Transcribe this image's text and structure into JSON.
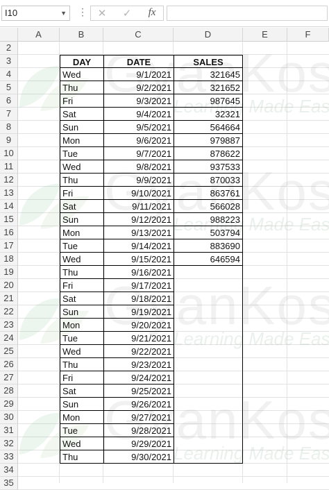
{
  "formula_bar": {
    "name_box": "I10",
    "icons": [
      "more-options-icon",
      "cancel-x-icon",
      "enter-check-icon",
      "insert-function-icon"
    ],
    "fx_label": "fx",
    "formula": ""
  },
  "columns": [
    "A",
    "B",
    "C",
    "D",
    "E",
    "F"
  ],
  "row_numbers": [
    "2",
    "3",
    "4",
    "5",
    "6",
    "7",
    "8",
    "9",
    "10",
    "11",
    "12",
    "13",
    "14",
    "15",
    "16",
    "17",
    "18",
    "19",
    "20",
    "21",
    "22",
    "23",
    "24",
    "25",
    "26",
    "27",
    "28",
    "29",
    "30",
    "31",
    "32",
    "33",
    "34",
    "35"
  ],
  "table": {
    "headers": [
      "DAY",
      "DATE",
      "SALES"
    ],
    "rows": [
      {
        "day": "Wed",
        "date": "9/1/2021",
        "sales": "321645"
      },
      {
        "day": "Thu",
        "date": "9/2/2021",
        "sales": "321652"
      },
      {
        "day": "Fri",
        "date": "9/3/2021",
        "sales": "987645"
      },
      {
        "day": "Sat",
        "date": "9/4/2021",
        "sales": "32321"
      },
      {
        "day": "Sun",
        "date": "9/5/2021",
        "sales": "564664"
      },
      {
        "day": "Mon",
        "date": "9/6/2021",
        "sales": "979887"
      },
      {
        "day": "Tue",
        "date": "9/7/2021",
        "sales": "878622"
      },
      {
        "day": "Wed",
        "date": "9/8/2021",
        "sales": "937533"
      },
      {
        "day": "Thu",
        "date": "9/9/2021",
        "sales": "870033"
      },
      {
        "day": "Fri",
        "date": "9/10/2021",
        "sales": "863761"
      },
      {
        "day": "Sat",
        "date": "9/11/2021",
        "sales": "566028"
      },
      {
        "day": "Sun",
        "date": "9/12/2021",
        "sales": "988223"
      },
      {
        "day": "Mon",
        "date": "9/13/2021",
        "sales": "503794"
      },
      {
        "day": "Tue",
        "date": "9/14/2021",
        "sales": "883690"
      },
      {
        "day": "Wed",
        "date": "9/15/2021",
        "sales": "646594"
      },
      {
        "day": "Thu",
        "date": "9/16/2021",
        "sales": ""
      },
      {
        "day": "Fri",
        "date": "9/17/2021",
        "sales": ""
      },
      {
        "day": "Sat",
        "date": "9/18/2021",
        "sales": ""
      },
      {
        "day": "Sun",
        "date": "9/19/2021",
        "sales": ""
      },
      {
        "day": "Mon",
        "date": "9/20/2021",
        "sales": ""
      },
      {
        "day": "Tue",
        "date": "9/21/2021",
        "sales": ""
      },
      {
        "day": "Wed",
        "date": "9/22/2021",
        "sales": ""
      },
      {
        "day": "Thu",
        "date": "9/23/2021",
        "sales": ""
      },
      {
        "day": "Fri",
        "date": "9/24/2021",
        "sales": ""
      },
      {
        "day": "Sat",
        "date": "9/25/2021",
        "sales": ""
      },
      {
        "day": "Sun",
        "date": "9/26/2021",
        "sales": ""
      },
      {
        "day": "Mon",
        "date": "9/27/2021",
        "sales": ""
      },
      {
        "day": "Tue",
        "date": "9/28/2021",
        "sales": ""
      },
      {
        "day": "Wed",
        "date": "9/29/2021",
        "sales": ""
      },
      {
        "day": "Thu",
        "date": "9/30/2021",
        "sales": ""
      }
    ]
  },
  "watermark": {
    "text": "GyanKosh",
    "tagline": "Learning Made Easy"
  }
}
